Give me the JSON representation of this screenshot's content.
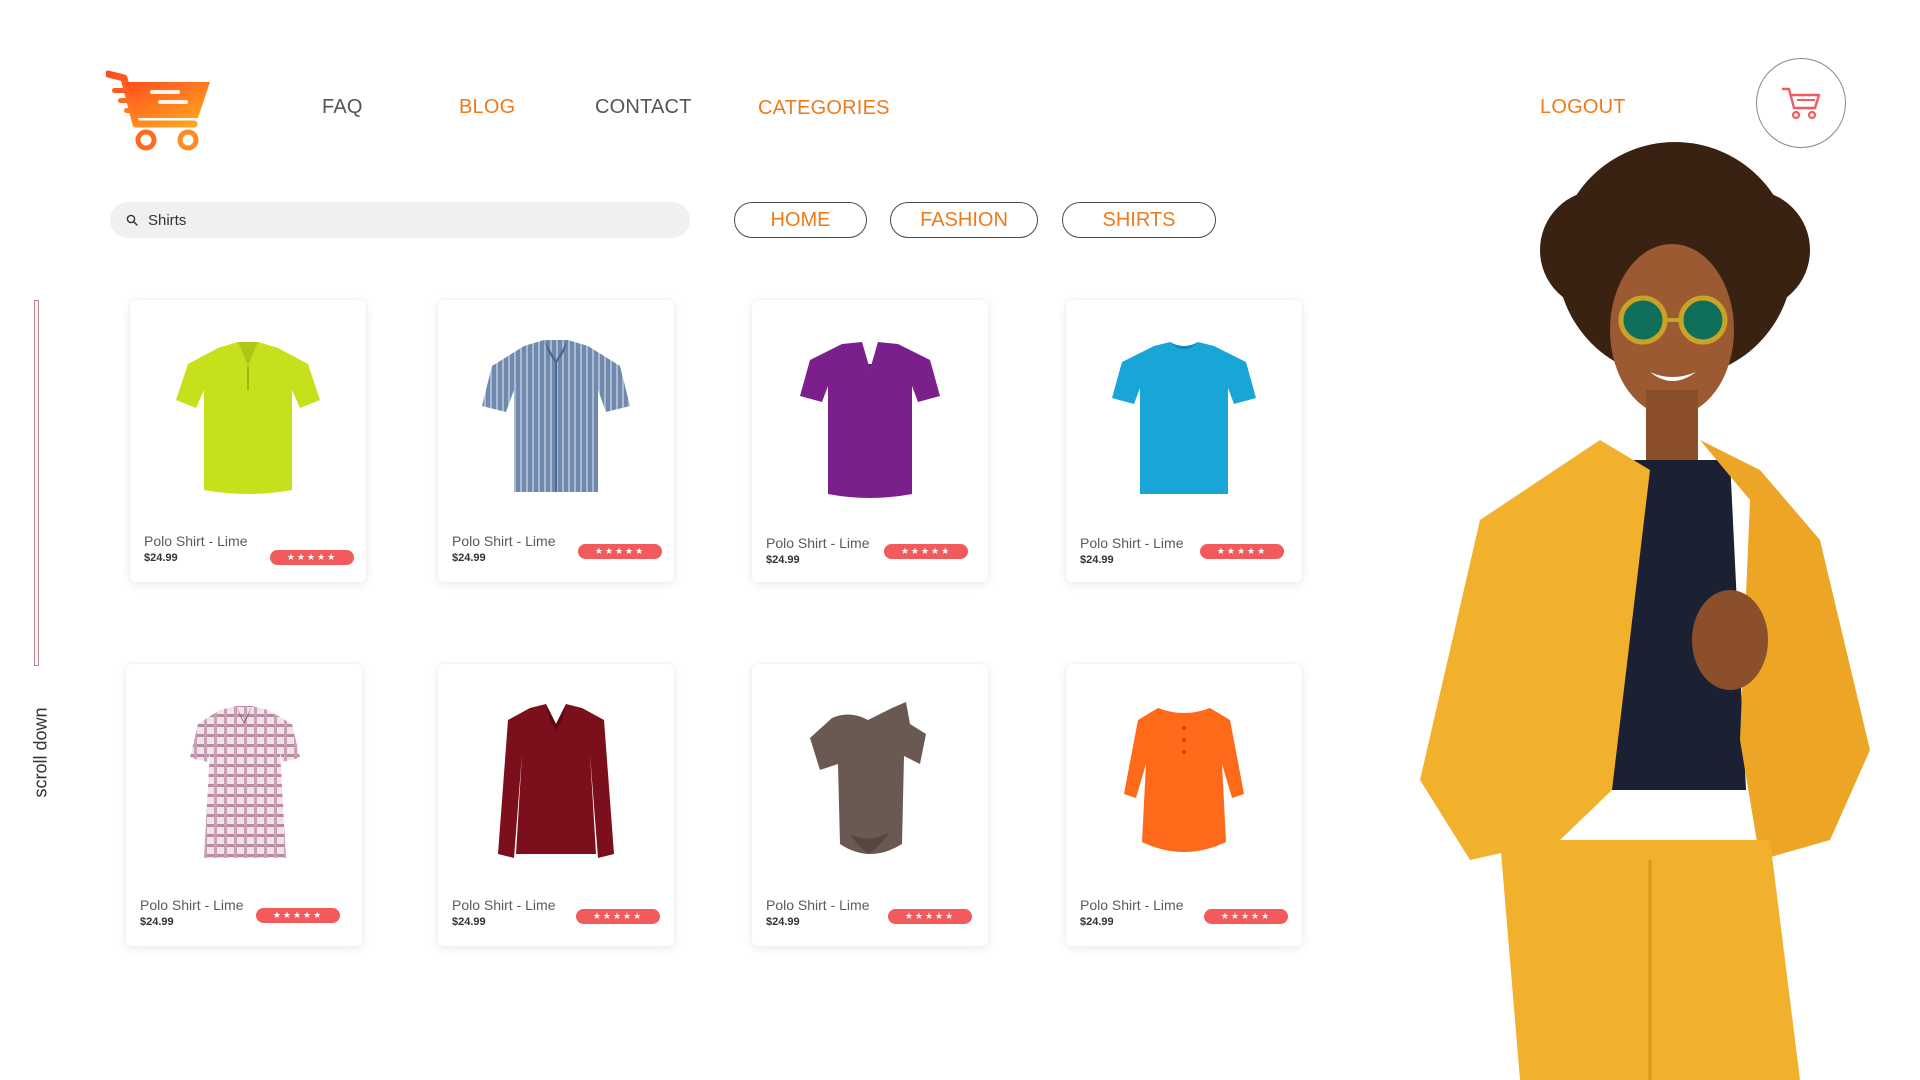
{
  "nav": {
    "faq": "FAQ",
    "blog": "BLOG",
    "contact": "CONTACT",
    "categories": "CATEGORIES",
    "logout": "LOGOUT"
  },
  "search": {
    "value": "Shirts"
  },
  "category_pills": [
    "HOME",
    "FASHION",
    "SHIRTS"
  ],
  "scroll_hint": "scroll down",
  "products": [
    {
      "name": "Polo Shirt - Lime",
      "price": "$24.99",
      "rating": "★★★★★"
    },
    {
      "name": "Polo Shirt - Lime",
      "price": "$24.99",
      "rating": "★★★★★"
    },
    {
      "name": "Polo Shirt - Lime",
      "price": "$24.99",
      "rating": "★★★★★"
    },
    {
      "name": "Polo Shirt - Lime",
      "price": "$24.99",
      "rating": "★★★★★"
    },
    {
      "name": "Polo Shirt - Lime",
      "price": "$24.99",
      "rating": "★★★★★"
    },
    {
      "name": "Polo Shirt - Lime",
      "price": "$24.99",
      "rating": "★★★★★"
    },
    {
      "name": "Polo Shirt - Lime",
      "price": "$24.99",
      "rating": "★★★★★"
    },
    {
      "name": "Polo Shirt - Lime",
      "price": "$24.99",
      "rating": "★★★★★"
    }
  ],
  "colors": {
    "accent": "#ef7a1a",
    "rating_badge": "#f25a5c",
    "shirt_lime": "#c6e11b",
    "shirt_blue_check": "#6f86a8",
    "shirt_purple": "#7a1f8c",
    "shirt_cyan": "#18a6d6",
    "shirt_plaid": "#d9b9c7",
    "shirt_maroon": "#7b0f1b",
    "shirt_brown": "#6a5852",
    "shirt_orange": "#ff6a1a",
    "suit_mustard": "#f2b12c"
  },
  "icons": [
    "cart-logo-icon",
    "search-icon",
    "shopping-cart-icon"
  ]
}
